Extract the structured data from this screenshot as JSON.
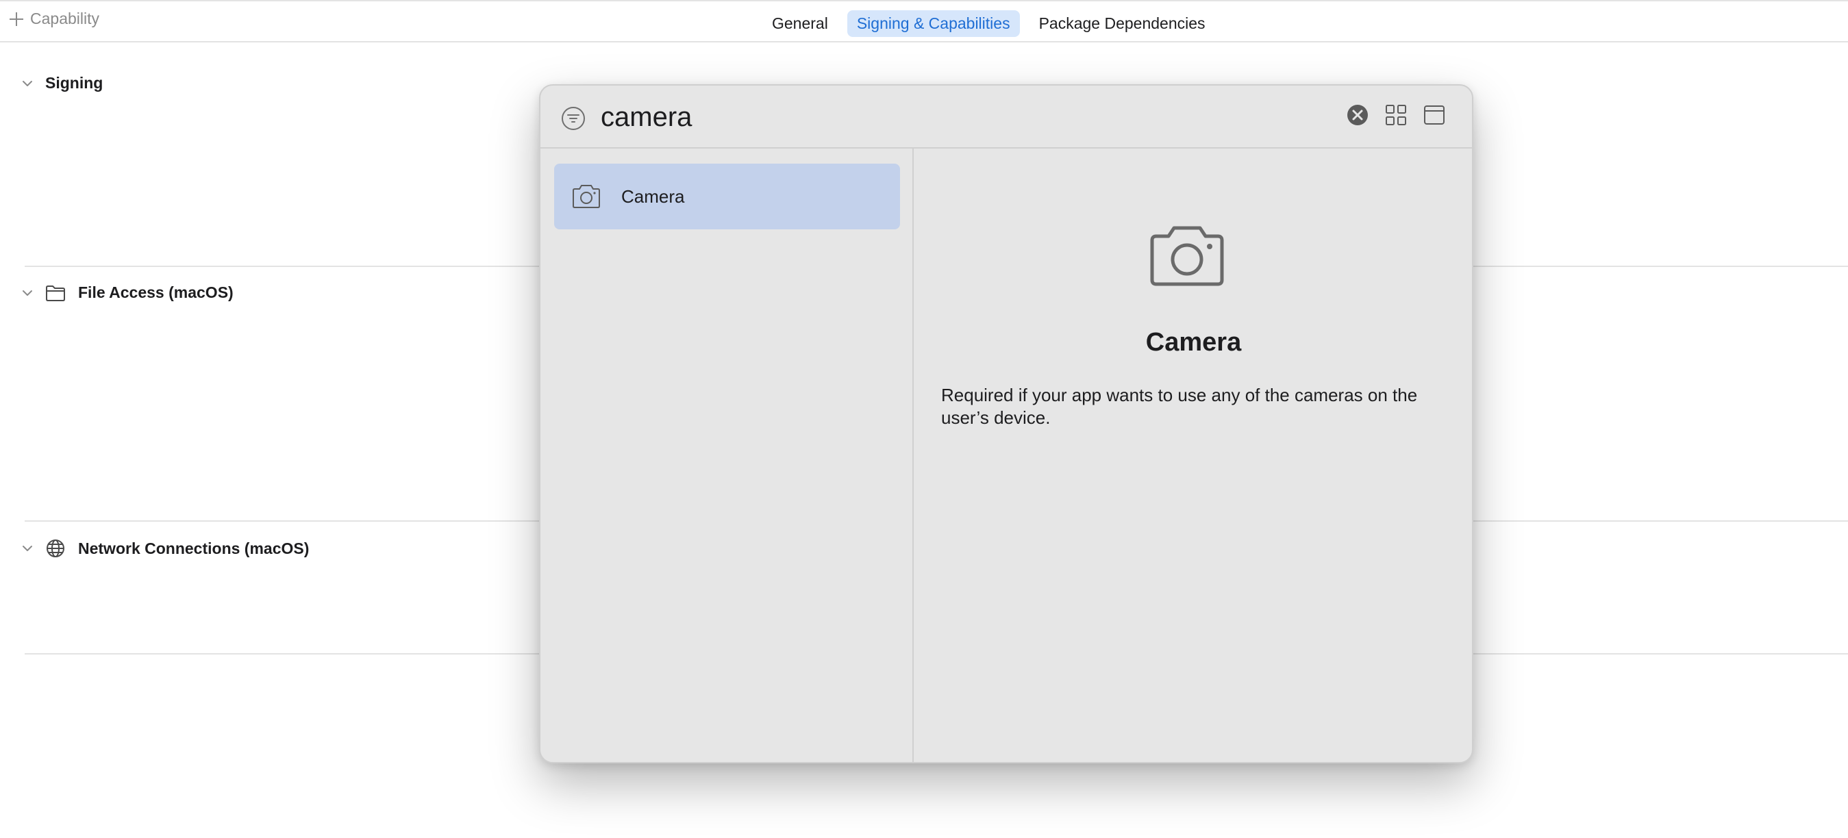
{
  "toolbar": {
    "add_capability_label": "Capability"
  },
  "tabs": [
    {
      "label": "General",
      "active": false
    },
    {
      "label": "Signing & Capabilities",
      "active": true
    },
    {
      "label": "Package Dependencies",
      "active": false
    }
  ],
  "sections": [
    {
      "title": "Signing",
      "icon": "none"
    },
    {
      "title": "File Access (macOS)",
      "icon": "folder-icon"
    },
    {
      "title": "Network Connections (macOS)",
      "icon": "globe-icon"
    }
  ],
  "library": {
    "search_value": "camera",
    "results": [
      {
        "label": "Camera",
        "icon": "camera-icon",
        "selected": true
      }
    ],
    "detail": {
      "title": "Camera",
      "icon": "camera-icon",
      "description": "Required if your app wants to use any of the cameras on the user’s device."
    }
  },
  "colors": {
    "accent": "#1f6ed4",
    "tab_active_bg": "#d6e6fb",
    "selection_bg": "#c3d1eb",
    "popup_bg": "#e6e6e6"
  }
}
